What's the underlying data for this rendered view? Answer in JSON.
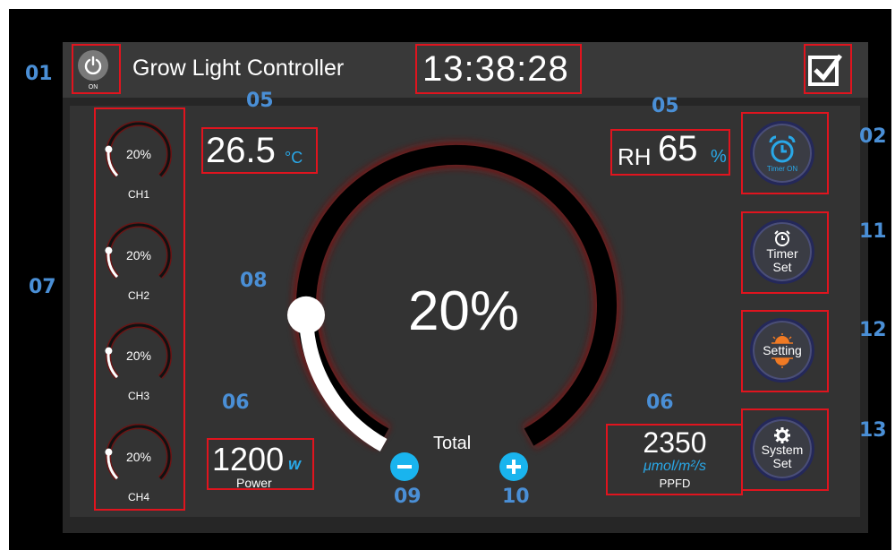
{
  "header": {
    "power_state": "ON",
    "title": "Grow Light Controller",
    "time": "13:38:28"
  },
  "channels": [
    {
      "label": "CH1",
      "value": "20%",
      "level": 0.2
    },
    {
      "label": "CH2",
      "value": "20%",
      "level": 0.2
    },
    {
      "label": "CH3",
      "value": "20%",
      "level": 0.2
    },
    {
      "label": "CH4",
      "value": "20%",
      "level": 0.2
    }
  ],
  "temperature": {
    "value": "26.5",
    "unit": "°C"
  },
  "humidity": {
    "label": "RH",
    "value": "65",
    "unit": "%"
  },
  "total": {
    "value": "20%",
    "label": "Total",
    "level": 0.2
  },
  "power": {
    "value": "1200",
    "unit": "w",
    "label": "Power"
  },
  "ppfd": {
    "value": "2350",
    "unit": "μmol/m²/s",
    "label": "PPFD"
  },
  "buttons": {
    "timer_on": "Timer ON",
    "timer_set_1": "Timer",
    "timer_set_2": "Set",
    "setting": "Setting",
    "system_set_1": "System",
    "system_set_2": "Set"
  },
  "callouts": {
    "c01": "01",
    "c02": "02",
    "c05a": "05",
    "c05b": "05",
    "c06a": "06",
    "c06b": "06",
    "c07": "07",
    "c08": "08",
    "c09": "09",
    "c10": "10",
    "c11": "11",
    "c12": "12",
    "c13": "13"
  },
  "colors": {
    "accent": "#29a8e8",
    "annotation_box": "#e0141e",
    "callout": "#4a8fd6",
    "dial_glow": "#8a1a1a"
  }
}
